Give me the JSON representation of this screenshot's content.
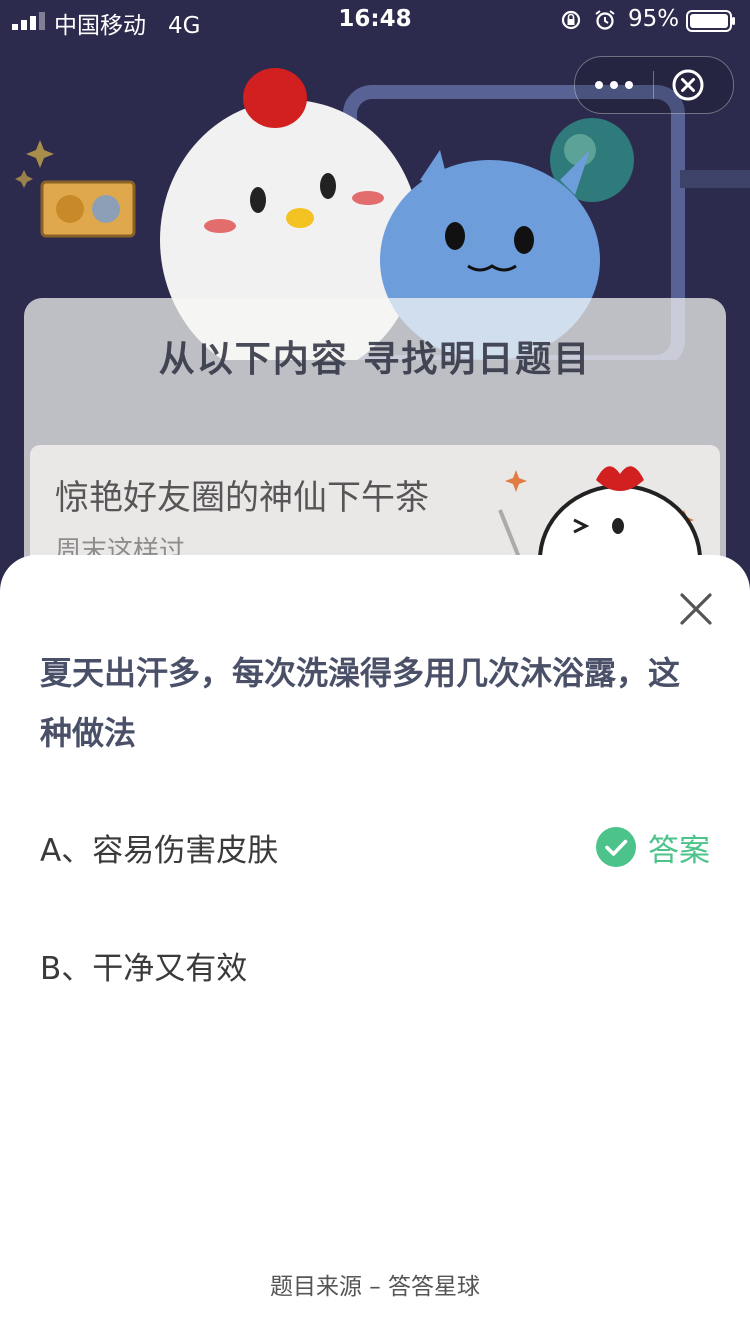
{
  "status_bar": {
    "carrier": "中国移动",
    "network": "4G",
    "time": "16:48",
    "battery_percent": "95%",
    "icons": [
      "signal-icon",
      "orientation-lock-icon",
      "alarm-icon",
      "battery-icon"
    ]
  },
  "capsule": {
    "icons": [
      "more-icon",
      "close-circle-icon"
    ]
  },
  "background": {
    "heading": "从以下内容 寻找明日题目",
    "article_title": "惊艳好友圈的神仙下午茶",
    "article_subtitle": "周末这样过"
  },
  "sheet": {
    "question": "夏天出汗多，每次洗澡得多用几次沐浴露，这种做法",
    "options": [
      {
        "label": "A、容易伤害皮肤",
        "is_answer": true
      },
      {
        "label": "B、干净又有效",
        "is_answer": false
      }
    ],
    "answer_label": "答案",
    "footer": "题目来源 – 答答星球"
  },
  "colors": {
    "bg_dark": "#2c2b4d",
    "question_text": "#4a5068",
    "answer_green": "#4cc38a"
  }
}
